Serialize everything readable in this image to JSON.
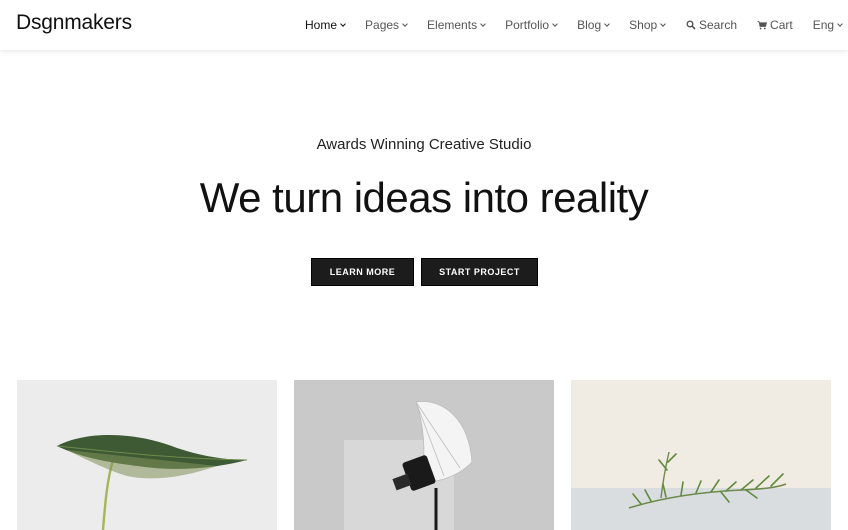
{
  "header": {
    "logo": "Dsgnmakers",
    "nav": [
      {
        "label": "Home",
        "active": true
      },
      {
        "label": "Pages"
      },
      {
        "label": "Elements"
      },
      {
        "label": "Portfolio"
      },
      {
        "label": "Blog"
      },
      {
        "label": "Shop"
      }
    ],
    "utility": {
      "search_label": "Search",
      "search_icon": "search-icon",
      "cart_label": "Cart",
      "cart_icon": "cart-icon",
      "lang_label": "Eng"
    }
  },
  "hero": {
    "tagline": "Awards Winning Creative Studio",
    "headline": "We turn ideas into reality",
    "buttons": {
      "learn_more": "LEARN MORE",
      "start_project": "START PROJECT"
    }
  },
  "cards": [
    {
      "image": "leaf-plant-photo"
    },
    {
      "image": "studio-umbrella-light-photo"
    },
    {
      "image": "rosemary-sprig-photo"
    }
  ],
  "colors": {
    "button_bg": "#1c1c1c",
    "text_primary": "#111111",
    "nav_text": "#555555"
  }
}
